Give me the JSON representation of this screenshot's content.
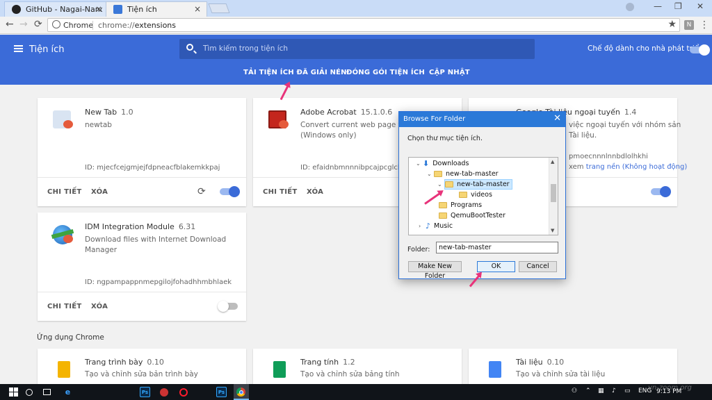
{
  "browser": {
    "tabs": [
      {
        "title": "GitHub - Nagai-Nano/ne",
        "icon": "github-icon",
        "close": "×"
      },
      {
        "title": "Tiện ích",
        "icon": "puzzle-icon",
        "close": "×"
      }
    ],
    "window_controls": {
      "minimize": "—",
      "maximize": "❐",
      "close": "✕"
    },
    "nav": {
      "back": "←",
      "forward": "→",
      "reload": "⟳"
    },
    "omnibox": {
      "security_label": "Chrome",
      "url_scheme": "chrome://",
      "url_host": "extensions",
      "bookmark_icon": "★"
    },
    "extension_badge": "N",
    "menu_icon": "⋮"
  },
  "header": {
    "title": "Tiện ích",
    "search_placeholder": "Tìm kiếm trong tiện ích",
    "dev_mode_label": "Chế độ dành cho nhà phát triển",
    "dev_mode_on": true,
    "links": [
      "TẢI TIỆN ÍCH ĐÃ GIẢI NÉN",
      "ĐÓNG GÓI TIỆN ÍCH",
      "CẬP NHẬT"
    ],
    "accent_color": "#3b6bd8"
  },
  "extensions": [
    {
      "name": "New Tab",
      "version": "1.0",
      "description": "newtab",
      "id": "ID: mjecfcejgmjejfdpneacfblakemkkpaj",
      "details": "CHI TIẾT",
      "remove": "XÓA",
      "reload": "⟳",
      "enabled": true
    },
    {
      "name": "Adobe Acrobat",
      "version": "15.1.0.6",
      "description": "Convert current web page to an A",
      "description2": "(Windows only)",
      "id": "ID: efaidnbmnnnibpcajpcglclefind",
      "details": "CHI TIẾT",
      "remove": "XÓA"
    },
    {
      "name": "Google Tài liệu ngoại tuyến",
      "version": "1.4",
      "description": "việc ngoại tuyến với nhóm sản",
      "description2": "Tài liệu.",
      "id": "pmoecnnnlnnbdlolhkhi",
      "view_prefix": "xem",
      "bg_link": "trang nền (Không hoạt động)",
      "enabled": true
    },
    {
      "name": "IDM Integration Module",
      "version": "6.31",
      "description": "Download files with Internet Download Manager",
      "id": "ID: ngpampappnmepgilojfohadhhmbhlaek",
      "details": "CHI TIẾT",
      "remove": "XÓA",
      "enabled": false
    }
  ],
  "apps_section": {
    "title": "Ứng dụng Chrome",
    "apps": [
      {
        "name": "Trang trình bày",
        "version": "0.10",
        "description": "Tạo và chỉnh sửa bản trình bày",
        "color": "#f4b400"
      },
      {
        "name": "Trang tính",
        "version": "1.2",
        "description": "Tạo và chỉnh sửa bảng tính",
        "color": "#0f9d58"
      },
      {
        "name": "Tài liệu",
        "version": "0.10",
        "description": "Tạo và chỉnh sửa tài liệu",
        "color": "#4285f4"
      }
    ]
  },
  "dialog": {
    "title": "Browse For Folder",
    "close": "✕",
    "prompt": "Chọn thư mục tiện ích.",
    "tree": [
      {
        "label": "Downloads",
        "expander": "⌄",
        "type": "downloads"
      },
      {
        "label": "new-tab-master",
        "expander": "⌄",
        "type": "folder"
      },
      {
        "label": "new-tab-master",
        "expander": "⌄",
        "type": "folder",
        "selected": true
      },
      {
        "label": "videos",
        "expander": "",
        "type": "folder"
      },
      {
        "label": "Programs",
        "expander": "",
        "type": "folder"
      },
      {
        "label": "QemuBootTester",
        "expander": "",
        "type": "folder"
      },
      {
        "label": "Music",
        "expander": "›",
        "type": "music"
      }
    ],
    "folder_label": "Folder:",
    "folder_value": "new-tab-master",
    "buttons": {
      "new_folder": "Make New Folder",
      "ok": "OK",
      "cancel": "Cancel"
    }
  },
  "taskbar": {
    "icons": [
      "windows-icon",
      "search-icon",
      "task-view-icon",
      "edge-icon",
      "photoshop-icon",
      "app-icon",
      "opera-icon",
      "photoshop-icon",
      "chrome-icon"
    ],
    "ps_label": "Ps",
    "language": "ENG",
    "time": "9:13 PM"
  },
  "watermark": "vn-zoom.org"
}
